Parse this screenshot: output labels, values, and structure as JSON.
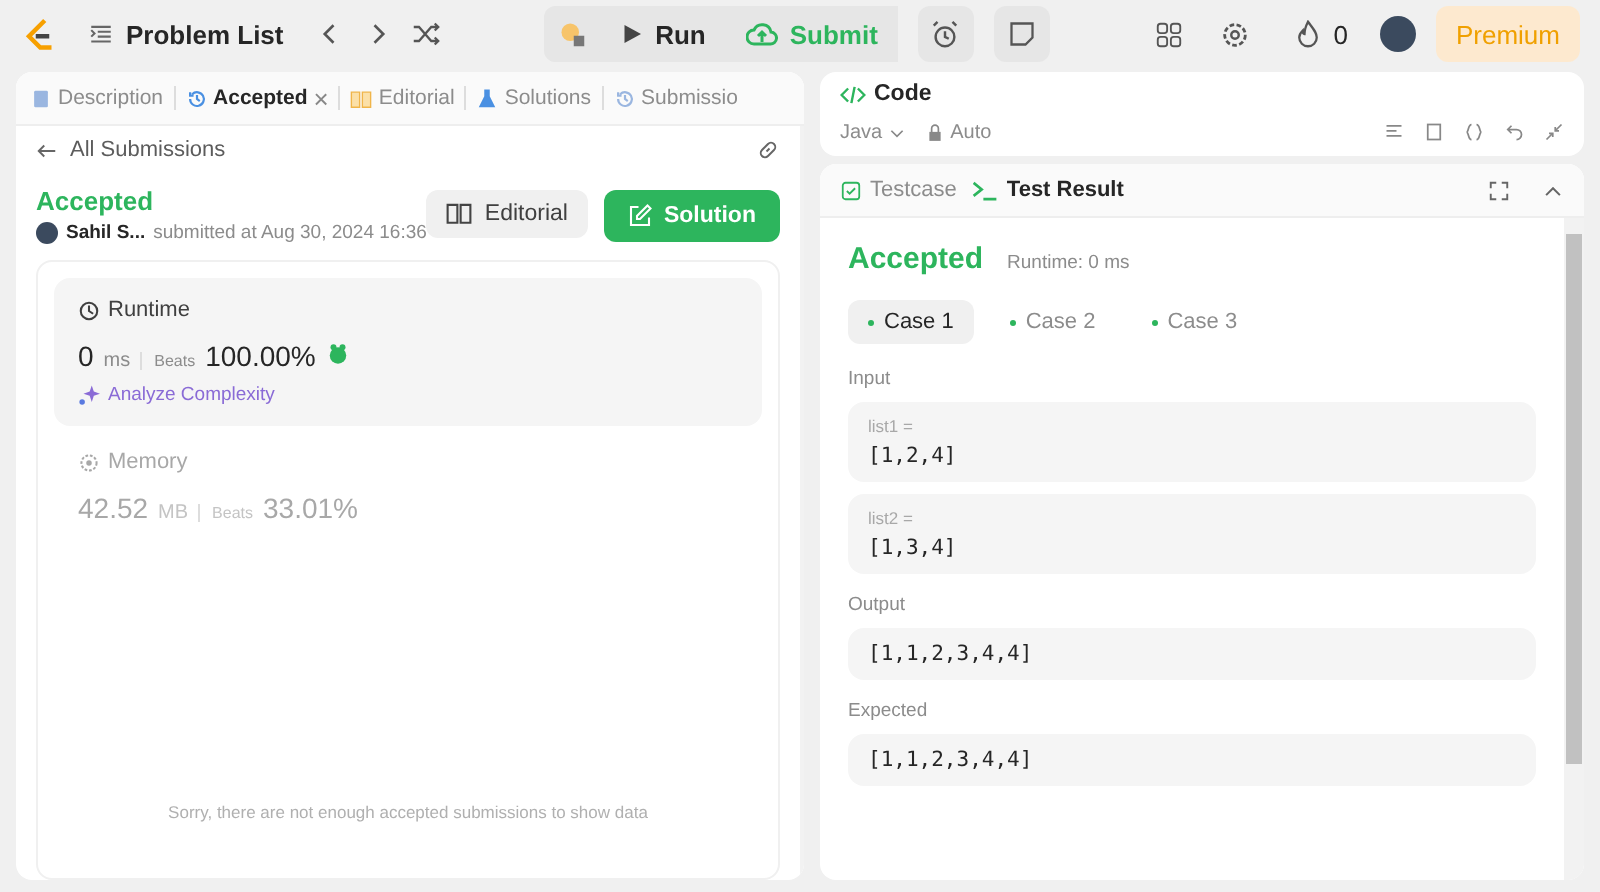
{
  "topbar": {
    "problem_list": "Problem List",
    "run": "Run",
    "submit": "Submit",
    "streak": "0",
    "premium": "Premium"
  },
  "left_panel": {
    "tabs": [
      {
        "label": "Description",
        "selected": false,
        "closable": false
      },
      {
        "label": "Accepted",
        "selected": true,
        "closable": true
      },
      {
        "label": "Editorial",
        "selected": false,
        "closable": false
      },
      {
        "label": "Solutions",
        "selected": false,
        "closable": false
      },
      {
        "label": "Submissio",
        "selected": false,
        "closable": false
      }
    ],
    "close_glyph": "×",
    "back_link": "All Submissions",
    "submission": {
      "status": "Accepted",
      "author": "Sahil S...",
      "submitted": "submitted at Aug 30, 2024 16:36",
      "editorial_button": "Editorial",
      "solution_button": "Solution"
    },
    "runtime": {
      "label": "Runtime",
      "value": "0",
      "unit": "ms",
      "beats_label": "Beats",
      "beats": "100.00%",
      "analyze": "Analyze Complexity"
    },
    "memory": {
      "label": "Memory",
      "value": "42.52",
      "unit": "MB",
      "beats_label": "Beats",
      "beats": "33.01%"
    },
    "empty_message": "Sorry, there are not enough accepted submissions to show data"
  },
  "code_panel": {
    "title": "Code",
    "language": "Java",
    "mode": "Auto"
  },
  "result_panel": {
    "tabs": [
      {
        "label": "Testcase",
        "selected": false
      },
      {
        "label": "Test Result",
        "selected": true
      }
    ],
    "status": "Accepted",
    "runtime": "Runtime: 0 ms",
    "cases": [
      {
        "label": "Case 1",
        "selected": true
      },
      {
        "label": "Case 2",
        "selected": false
      },
      {
        "label": "Case 3",
        "selected": false
      }
    ],
    "input_label": "Input",
    "inputs": [
      {
        "name": "list1 =",
        "value": "[1,2,4]"
      },
      {
        "name": "list2 =",
        "value": "[1,3,4]"
      }
    ],
    "output_label": "Output",
    "output": "[1,1,2,3,4,4]",
    "expected_label": "Expected",
    "expected": "[1,1,2,3,4,4]"
  }
}
